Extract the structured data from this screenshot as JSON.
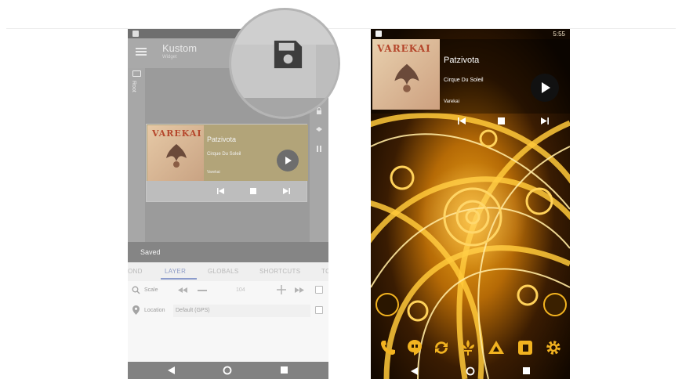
{
  "left_phone": {
    "app_title": "Kustom",
    "app_subtitle": "Widget",
    "sidebar_root": "Root",
    "widget": {
      "art_text": "VAREKAI",
      "title": "Patzivota",
      "artist": "Cirque Du Soleil",
      "album": "Varekai"
    },
    "saved_message": "Saved",
    "tabs": [
      "OND",
      "LAYER",
      "GLOBALS",
      "SHORTCUTS",
      "TC"
    ],
    "active_tab": "LAYER",
    "scale_row": {
      "label": "Scale",
      "value": "104"
    },
    "location_row": {
      "label": "Location",
      "value": "Default (GPS)"
    }
  },
  "right_phone": {
    "art_text": "VAREKAI",
    "title": "Patzivota",
    "artist": "Cirque Du Soleil",
    "album": "Varekai",
    "time": "5:55"
  },
  "colors": {
    "accent_tab": "#8c9ccc",
    "gold": "#f2b320"
  },
  "icons": [
    "floppy-save-icon",
    "play-icon",
    "skip-previous-icon",
    "stop-icon",
    "skip-next-icon",
    "phone-icon",
    "hangouts-icon",
    "sync-icon",
    "fleur-de-lis-icon",
    "drive-icon",
    "files-icon",
    "settings-icon"
  ]
}
